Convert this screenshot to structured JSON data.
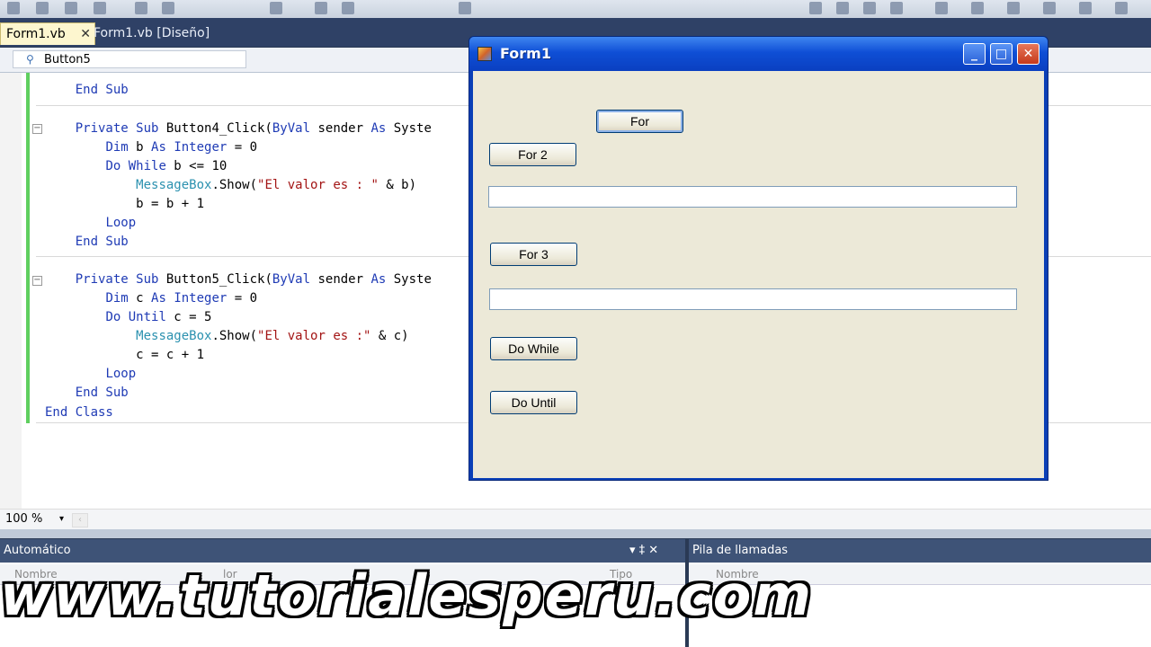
{
  "tabs": [
    {
      "label": "Form1.vb",
      "close": "✕"
    },
    {
      "label": "Form1.vb [Diseño]"
    }
  ],
  "nav_combo": {
    "label": "Button5"
  },
  "code_lines": {
    "l1": "    End Sub",
    "l2a": "    ",
    "l2b": "Private Sub",
    "l2c": " Button4_Click(",
    "l2d": "ByVal",
    "l2e": " sender ",
    "l2f": "As",
    "l2g": " Syste",
    "l3a": "        ",
    "l3b": "Dim",
    "l3c": " b ",
    "l3d": "As Integer",
    "l3e": " = 0",
    "l4a": "        ",
    "l4b": "Do While",
    "l4c": " b <= 10",
    "l5a": "            ",
    "l5b": "MessageBox",
    "l5c": ".Show(",
    "l5d": "\"El valor es : \"",
    "l5e": " & b)",
    "l6": "            b = b + 1",
    "l7a": "        ",
    "l7b": "Loop",
    "l8a": "    ",
    "l8b": "End Sub",
    "l9a": "    ",
    "l9b": "Private Sub",
    "l9c": " Button5_Click(",
    "l9d": "ByVal",
    "l9e": " sender ",
    "l9f": "As",
    "l9g": " Syste",
    "l10a": "        ",
    "l10b": "Dim",
    "l10c": " c ",
    "l10d": "As Integer",
    "l10e": " = 0",
    "l11a": "        ",
    "l11b": "Do Until",
    "l11c": " c = 5",
    "l12a": "            ",
    "l12b": "MessageBox",
    "l12c": ".Show(",
    "l12d": "\"El valor es :\"",
    "l12e": " & c)",
    "l13": "            c = c + 1",
    "l14a": "        ",
    "l14b": "Loop",
    "l15a": "    ",
    "l15b": "End Sub",
    "l16": "End Class"
  },
  "status": {
    "zoom": "100 %",
    "dropdown": "▾",
    "scroll": "‹"
  },
  "panels": {
    "auto": {
      "title": "Automático",
      "col1": "Nombre",
      "col2": "lor",
      "col3": "Tipo",
      "controls": "▾ ‡ ✕"
    },
    "calls": {
      "title": "Pila de llamadas",
      "col1": "Nombre"
    }
  },
  "form1": {
    "caption": "Form1",
    "min": "_",
    "max": "□",
    "close": "✕",
    "buttons": {
      "for": "For",
      "for2": "For 2",
      "for3": "For 3",
      "dowhile": "Do While",
      "dountil": "Do Until"
    }
  },
  "watermark": "www.tutorialesperu.com"
}
